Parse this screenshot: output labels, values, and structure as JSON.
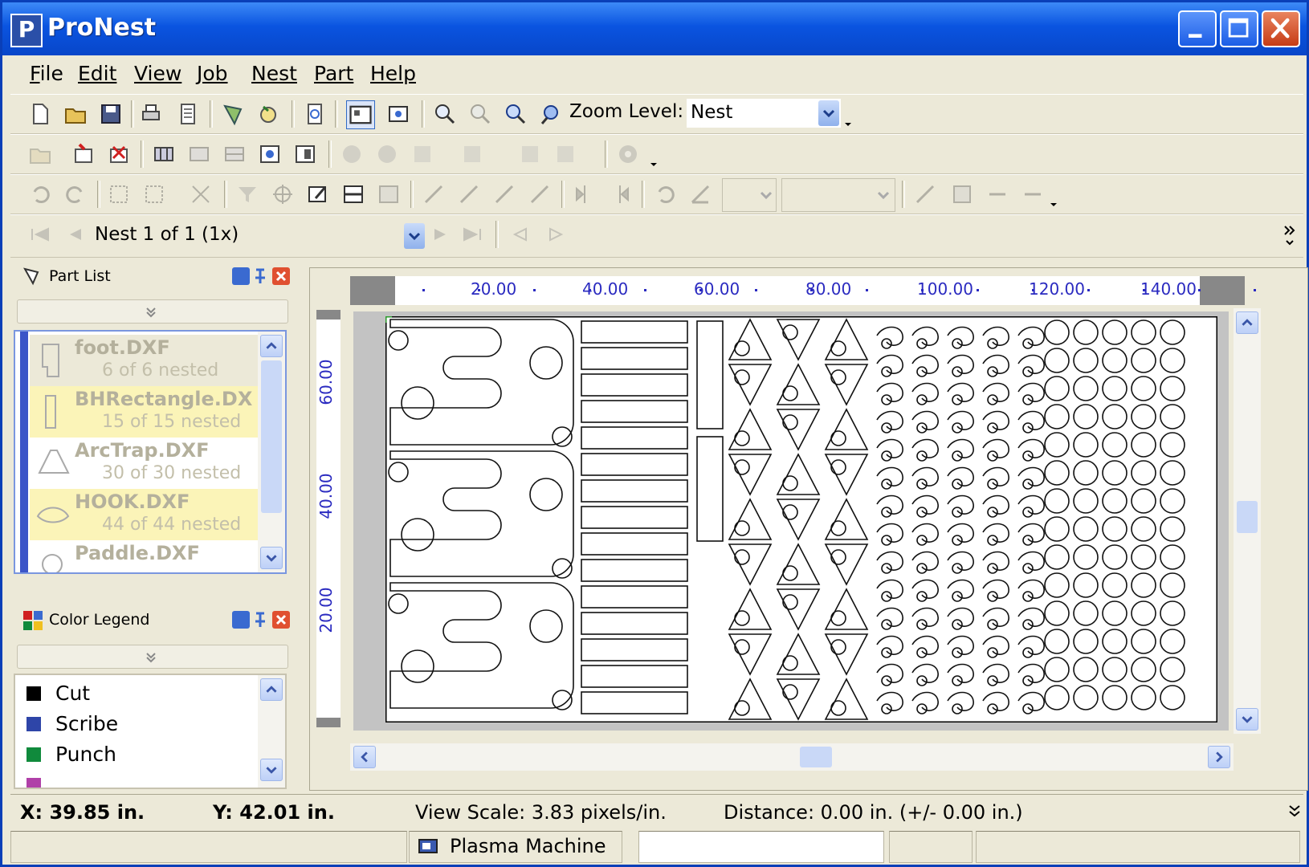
{
  "window": {
    "title": "ProNest"
  },
  "menu": [
    "File",
    "Edit",
    "View",
    "Job",
    "Nest",
    "Part",
    "Help"
  ],
  "menu_accel": [
    "F",
    "E",
    "V",
    "J",
    "N",
    "P",
    "H"
  ],
  "toolbar": {
    "zoom_label": "Zoom Level:",
    "zoom_value": "Nest"
  },
  "nest_nav": {
    "value": "Nest 1 of 1 (1x)"
  },
  "part_list": {
    "title": "Part List",
    "items": [
      {
        "name": "foot.DXF",
        "status": "6 of 6 nested"
      },
      {
        "name": "BHRectangle.DX",
        "status": "15 of 15 nested"
      },
      {
        "name": "ArcTrap.DXF",
        "status": "30 of 30 nested"
      },
      {
        "name": "HOOK.DXF",
        "status": "44 of 44 nested"
      },
      {
        "name": "Paddle.DXF",
        "status": ""
      }
    ]
  },
  "color_legend": {
    "title": "Color Legend",
    "items": [
      {
        "label": "Cut",
        "color": "#000000"
      },
      {
        "label": "Scribe",
        "color": "#2e45a8"
      },
      {
        "label": "Punch",
        "color": "#108a3c"
      },
      {
        "label": "",
        "color": "#b040a8"
      }
    ]
  },
  "ruler": {
    "h_labels": [
      "20.00",
      "40.00",
      "60.00",
      "80.00",
      "100.00",
      "120.00",
      "140.00"
    ],
    "v_labels": [
      "60.00",
      "40.00",
      "20.00"
    ]
  },
  "status": {
    "x": "X: 39.85 in.",
    "y": "Y: 42.01 in.",
    "view_scale": "View Scale: 3.83 pixels/in.",
    "distance": "Distance: 0.00 in. (+/- 0.00 in.)",
    "machine": "Plasma Machine"
  },
  "colors": {
    "title_bar": "#0a54e0",
    "window_bg": "#ece9d8",
    "ruler_text": "#2a2ac0",
    "selected_row": "#fbf4b8"
  }
}
